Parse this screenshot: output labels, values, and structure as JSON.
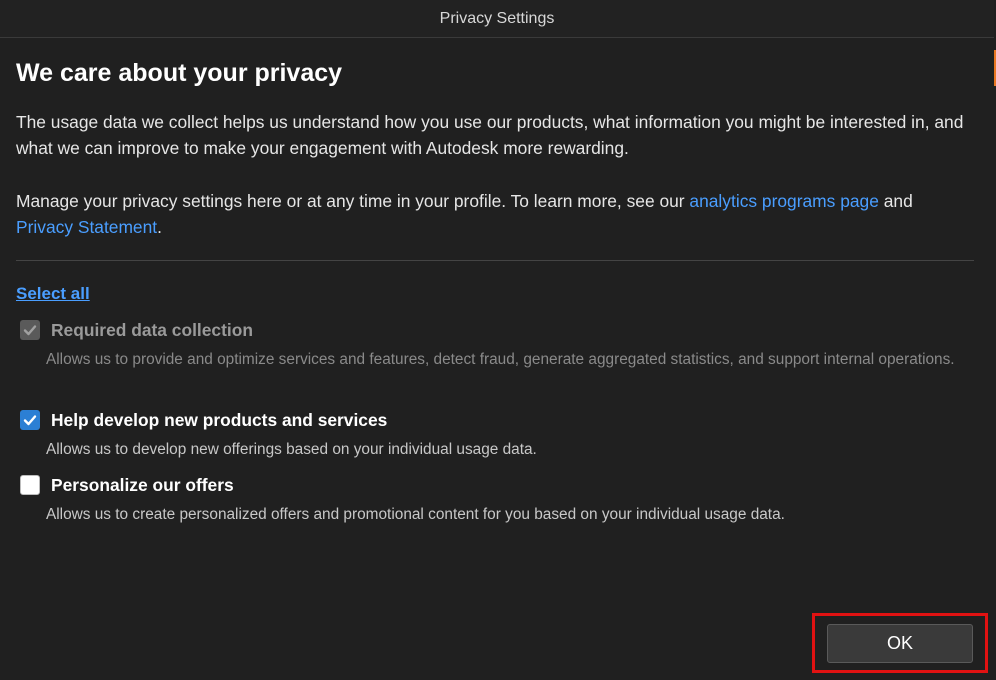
{
  "window": {
    "title": "Privacy Settings"
  },
  "main": {
    "heading": "We care about your privacy",
    "paragraph1": "The usage data we collect helps us understand how you use our products, what information you might be interested in, and what we can improve to make your engagement with Autodesk more rewarding.",
    "paragraph2": {
      "prefix": "Manage your privacy settings here or at any time in your profile. To learn more, see our ",
      "link1": "analytics programs page",
      "middle": " and ",
      "link2": "Privacy Statement",
      "suffix": "."
    },
    "select_all": "Select all",
    "options": [
      {
        "label": "Required data collection",
        "description": "Allows us to provide and optimize services and features, detect fraud, generate aggregated statistics, and support internal operations.",
        "checked": true,
        "disabled": true
      },
      {
        "label": "Help develop new products and services",
        "description": "Allows us to develop new offerings based on your individual usage data.",
        "checked": true,
        "disabled": false
      },
      {
        "label": "Personalize our offers",
        "description": "Allows us to create personalized offers and promotional content for you based on your individual usage data.",
        "checked": false,
        "disabled": false
      }
    ],
    "ok_label": "OK"
  },
  "colors": {
    "background": "#202020",
    "link": "#4a9eff",
    "checkbox_checked": "#2b7fd4",
    "highlight": "#e11212"
  },
  "icons": {
    "checkmark": "checkmark-icon"
  }
}
